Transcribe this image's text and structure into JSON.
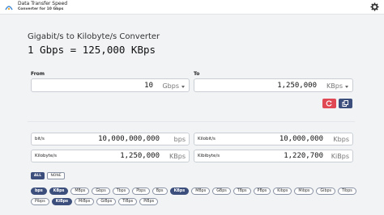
{
  "app": {
    "title": "Data Transfer Speed",
    "subtitle": "Converter for 10 Gbps"
  },
  "main": {
    "heading": "Gigabit/s to Kilobyte/s Converter",
    "result": "1 Gbps = 125,000 KBps"
  },
  "from": {
    "label": "From",
    "value": "10",
    "unit": "Gbps"
  },
  "to": {
    "label": "To",
    "value": "1,250,000",
    "unit": "KBps"
  },
  "results": [
    {
      "name": "bit/s",
      "value": "10,000,000,000",
      "unit": "bps"
    },
    {
      "name": "Kilobit/s",
      "value": "10,000,000",
      "unit": "Kbps"
    },
    {
      "name": "Kilobyte/s",
      "value": "1,250,000",
      "unit": "KBps"
    },
    {
      "name": "Kibibyte/s",
      "value": "1,220,700",
      "unit": "KiBps"
    }
  ],
  "filters": {
    "all": "ALL",
    "none": "NONE"
  },
  "chips_row1": [
    {
      "label": "bps",
      "selected": true
    },
    {
      "label": "KBps",
      "selected": true
    },
    {
      "label": "MBps",
      "selected": false
    },
    {
      "label": "Gbps",
      "selected": false
    },
    {
      "label": "Tbps",
      "selected": false
    },
    {
      "label": "Pbps",
      "selected": false
    },
    {
      "label": "Bps",
      "selected": false
    },
    {
      "label": "KBps",
      "selected": true
    },
    {
      "label": "MBps",
      "selected": false
    },
    {
      "label": "GBps",
      "selected": false
    },
    {
      "label": "TBps",
      "selected": false
    },
    {
      "label": "PBps",
      "selected": false
    },
    {
      "label": "Kibps",
      "selected": false
    },
    {
      "label": "Mibps",
      "selected": false
    },
    {
      "label": "Gibps",
      "selected": false
    },
    {
      "label": "Tibps",
      "selected": false
    }
  ],
  "chips_row2": [
    {
      "label": "Pibps",
      "selected": false
    },
    {
      "label": "KiBps",
      "selected": true
    },
    {
      "label": "MiBps",
      "selected": false
    },
    {
      "label": "GiBps",
      "selected": false
    },
    {
      "label": "TiBps",
      "selected": false
    },
    {
      "label": "PiBps",
      "selected": false
    }
  ]
}
